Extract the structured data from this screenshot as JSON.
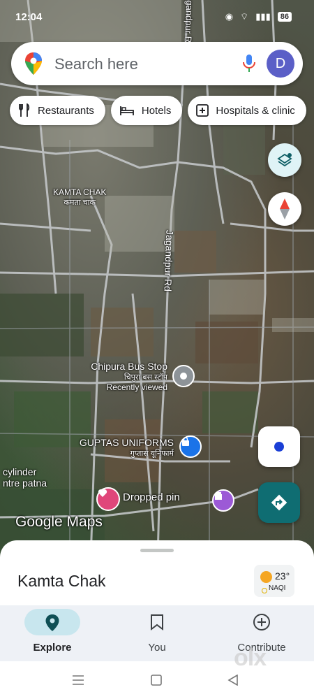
{
  "status_bar": {
    "time": "12:04",
    "battery": "86"
  },
  "search": {
    "placeholder": "Search here",
    "avatar_letter": "D"
  },
  "chips": [
    {
      "label": "Restaurants",
      "icon": "fork-knife-icon"
    },
    {
      "label": "Hotels",
      "icon": "bed-icon"
    },
    {
      "label": "Hospitals & clinic",
      "icon": "hospital-cross-icon"
    }
  ],
  "map": {
    "road_label": "Jagandpur Rd",
    "locality": {
      "name": "KAMTA CHAK",
      "name_hindi": "कमता चाक"
    },
    "places": {
      "bus_stop": {
        "name": "Chipura Bus Stop",
        "name_hindi": "चिपुरा बस स्टॉप",
        "note": "Recently viewed"
      },
      "uniforms": {
        "name": "GUPTAS UNIFORMS",
        "name_hindi": "गुप्तास यूनिफार्म"
      },
      "dropped_pin": {
        "name": "Dropped pin"
      },
      "cylinder": {
        "line1": "cylinder",
        "line2": "ntre patna"
      }
    },
    "watermark": "Google Maps"
  },
  "sheet": {
    "title": "Kamta Chak",
    "weather": {
      "temp": "23°",
      "aqi": "NAQI"
    }
  },
  "bottom_nav": [
    {
      "label": "Explore",
      "active": true
    },
    {
      "label": "You",
      "active": false
    },
    {
      "label": "Contribute",
      "active": false
    }
  ],
  "colors": {
    "accent": "#1a73e8",
    "directions": "#0f6d72",
    "pin_red": "#ea4335"
  }
}
